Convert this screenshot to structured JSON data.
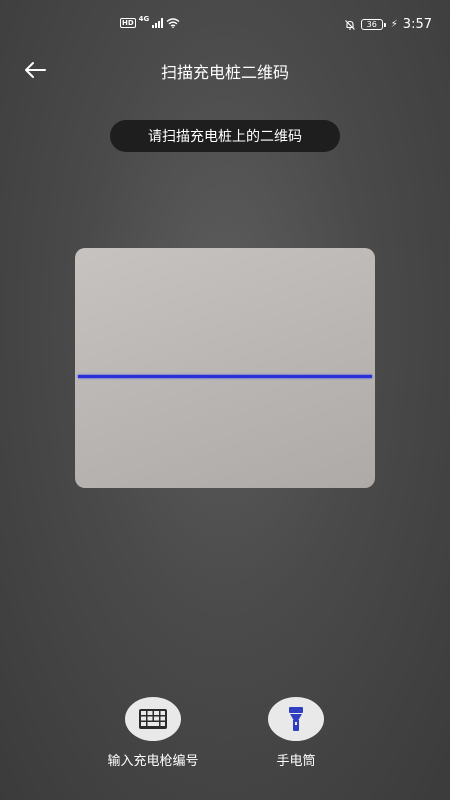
{
  "status_bar": {
    "hd": "HD",
    "network": "4G",
    "battery": "36",
    "time": "3:57"
  },
  "header": {
    "title": "扫描充电桩二维码"
  },
  "hint": {
    "text": "请扫描充电桩上的二维码"
  },
  "tools": {
    "input_code_label": "输入充电枪编号",
    "flashlight_label": "手电筒"
  },
  "colors": {
    "scan_line": "#2a2fd6",
    "hint_background": "#1e1e1e",
    "tool_button": "#e9e9e9",
    "flashlight_icon": "#2f3fc2"
  }
}
